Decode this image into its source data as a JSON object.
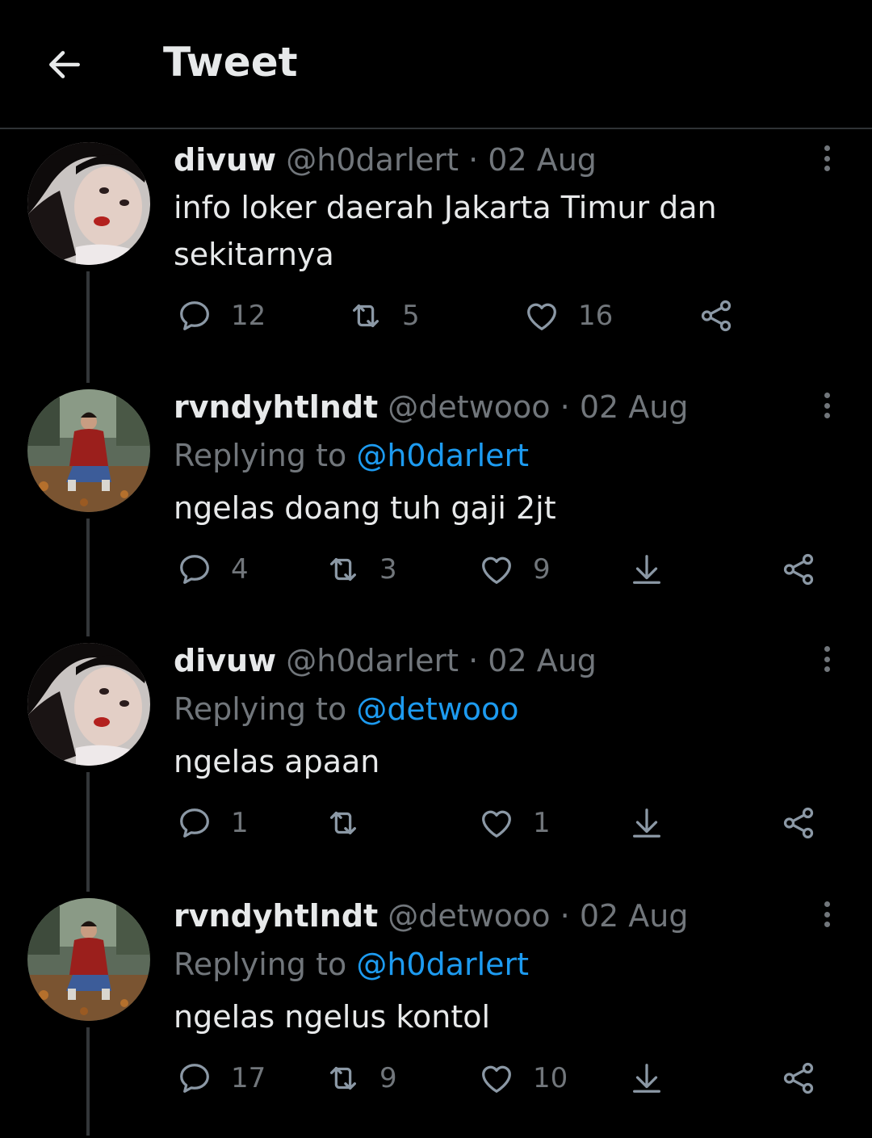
{
  "header": {
    "title": "Tweet"
  },
  "colors": {
    "background": "#000000",
    "text": "#e7e9ea",
    "muted": "#71767b",
    "link": "#1d9bf0",
    "divider": "#2f3336"
  },
  "tweets": [
    {
      "name": "divuw",
      "handle": "@h0darlert",
      "separator": "·",
      "date": "02 Aug",
      "replying_prefix": "",
      "replying_to": "",
      "text": "info loker daerah Jakarta Timur dan sekitarnya",
      "replies": "12",
      "retweets": "5",
      "likes": "16"
    },
    {
      "name": "rvndyhtlndt",
      "handle": "@detwooo",
      "separator": "·",
      "date": "02 Aug",
      "replying_prefix": "Replying to ",
      "replying_to": "@h0darlert",
      "text": "ngelas doang tuh gaji 2jt",
      "replies": "4",
      "retweets": "3",
      "likes": "9"
    },
    {
      "name": "divuw",
      "handle": "@h0darlert",
      "separator": "·",
      "date": "02 Aug",
      "replying_prefix": "Replying to ",
      "replying_to": "@detwooo",
      "text": "ngelas apaan",
      "replies": "1",
      "retweets": "",
      "likes": "1"
    },
    {
      "name": "rvndyhtlndt",
      "handle": "@detwooo",
      "separator": "·",
      "date": "02 Aug",
      "replying_prefix": "Replying to ",
      "replying_to": "@h0darlert",
      "text": "ngelas ngelus kontol",
      "replies": "17",
      "retweets": "9",
      "likes": "10"
    }
  ]
}
